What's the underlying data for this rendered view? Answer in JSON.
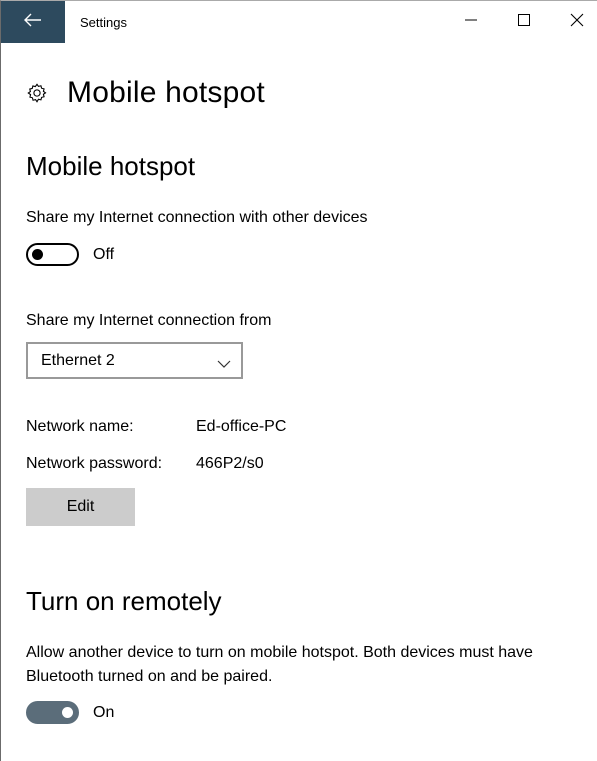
{
  "titlebar": {
    "title": "Settings",
    "back_icon": "arrow-left-icon",
    "controls": [
      "minimize-icon",
      "maximize-icon",
      "close-icon"
    ],
    "accent": "#2d4a5e"
  },
  "header": {
    "icon": "gear-icon",
    "title": "Mobile hotspot"
  },
  "hotspot": {
    "section_title": "Mobile hotspot",
    "share_label": "Share my Internet connection with other devices",
    "share_toggle_state": "Off",
    "share_from_label": "Share my Internet connection from",
    "share_from_selected": "Ethernet 2",
    "network_name_label": "Network name:",
    "network_name_value": "Ed-office-PC",
    "network_password_label": "Network password:",
    "network_password_value": "466P2/s0",
    "edit_label": "Edit"
  },
  "remote": {
    "section_title": "Turn on remotely",
    "description": "Allow another device to turn on mobile hotspot. Both devices must have Bluetooth turned on and be paired.",
    "toggle_state": "On",
    "toggle_color": "#5b6d7a"
  }
}
